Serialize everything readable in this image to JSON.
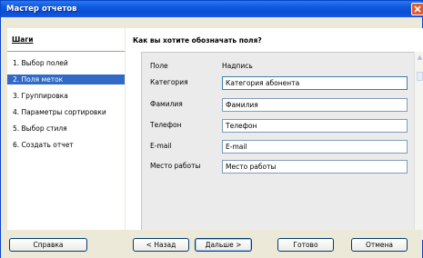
{
  "window": {
    "title": "Мастер отчетов"
  },
  "sidebar": {
    "heading": "Шаги",
    "steps": [
      {
        "label": "1. Выбор полей"
      },
      {
        "label": "2. Поля меток",
        "active": true
      },
      {
        "label": "3. Группировка"
      },
      {
        "label": "4. Параметры сортировки"
      },
      {
        "label": "5. Выбор стиля"
      },
      {
        "label": "6. Создать отчет"
      }
    ]
  },
  "main": {
    "question": "Как вы хотите обозначать поля?",
    "col_field": "Поле",
    "col_label": "Надпись",
    "rows": [
      {
        "field": "Категория",
        "value": "Категория абонента"
      },
      {
        "field": "Фамилия",
        "value": "Фамилия"
      },
      {
        "field": "Телефон",
        "value": "Телефон"
      },
      {
        "field": "E-mail",
        "value": "E-mail"
      },
      {
        "field": "Место работы",
        "value": "Место работы"
      }
    ]
  },
  "buttons": {
    "help": "Справка",
    "back": "< Назад",
    "next": "Дальше >",
    "finish": "Готово",
    "cancel": "Отмена"
  },
  "colors": {
    "title_bar": "#0a4ed3",
    "selection": "#316ac5",
    "close": "#e05a2e"
  }
}
